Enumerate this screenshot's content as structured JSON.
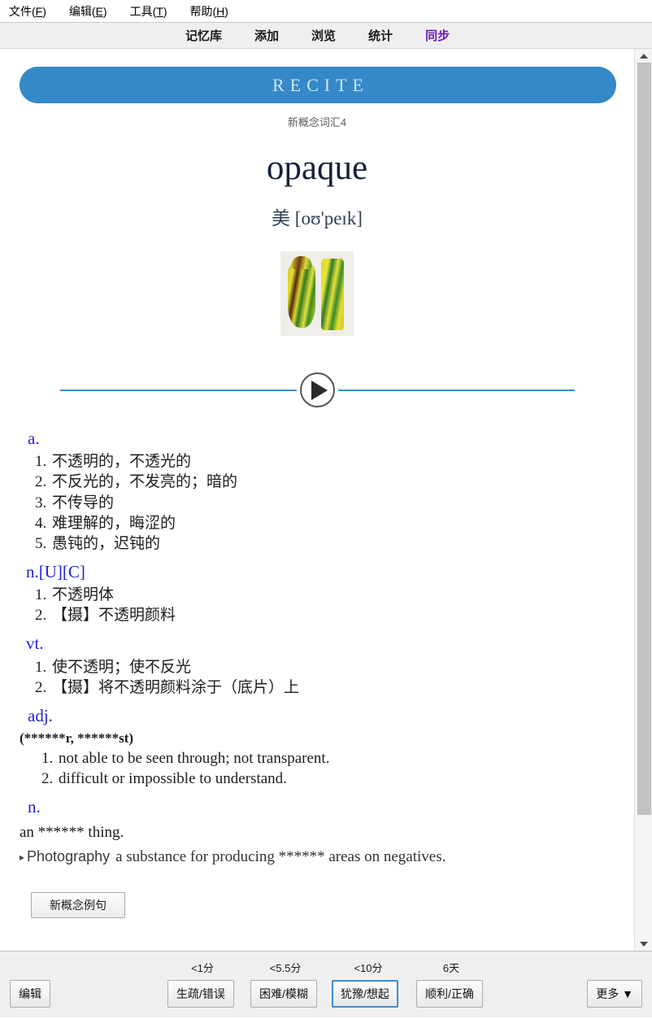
{
  "menubar": {
    "items": [
      {
        "name": "file",
        "label": "文件(F)",
        "accel": "F"
      },
      {
        "name": "edit",
        "label": "编辑(E)",
        "accel": "E"
      },
      {
        "name": "tools",
        "label": "工具(T)",
        "accel": "T"
      },
      {
        "name": "help",
        "label": "帮助(H)",
        "accel": "H"
      }
    ]
  },
  "navbar": {
    "items": [
      {
        "label": "记忆库",
        "active": false
      },
      {
        "label": "添加",
        "active": false
      },
      {
        "label": "浏览",
        "active": false
      },
      {
        "label": "统计",
        "active": false
      },
      {
        "label": "同步",
        "active": true
      }
    ],
    "active_color": "#6a19b8"
  },
  "card": {
    "banner_label": "RECITE",
    "banner_color": "#3589c8",
    "deck_name": "新概念词汇4",
    "headword": "opaque",
    "phonetic_region": "美",
    "phonetic": "[oʊ'peɪk]",
    "image_alt": "two yellow and green striped vases",
    "play_button_label": "play-audio",
    "entries": [
      {
        "pos": "a.",
        "senses": [
          "不透明的，不透光的",
          "不反光的，不发亮的；暗的",
          "不传导的",
          "难理解的，晦涩的",
          "愚钝的，迟钝的"
        ]
      },
      {
        "pos": "n.[U][C]",
        "senses": [
          "不透明体",
          "【摄】不透明颜料"
        ]
      },
      {
        "pos": "vt.",
        "senses": [
          "使不透明；使不反光",
          "【摄】将不透明颜料涂于（底片）上"
        ]
      },
      {
        "pos": "adj.",
        "inflection": "(******r, ******st)",
        "senses": [
          "not able to be seen through; not transparent.",
          "difficult or impossible to understand."
        ]
      },
      {
        "pos": "n.",
        "plain": "an ****** thing.",
        "domain_note": {
          "domain": "Photography",
          "text": "a substance for producing ****** areas on negatives."
        }
      }
    ],
    "example_button_label": "新概念例句"
  },
  "toolbar": {
    "edit_label": "编辑",
    "more_label": "更多 ▼",
    "grades": [
      {
        "interval": "<1分",
        "label": "生疏/错误",
        "focused": false
      },
      {
        "interval": "<5.5分",
        "label": "困难/模糊",
        "focused": false
      },
      {
        "interval": "<10分",
        "label": "犹豫/想起",
        "focused": true
      },
      {
        "interval": "6天",
        "label": "顺利/正确",
        "focused": false
      }
    ]
  },
  "scrollbar": {
    "up_arrow": "scroll-up",
    "down_arrow": "scroll-down",
    "thumb": "scroll-thumb"
  }
}
